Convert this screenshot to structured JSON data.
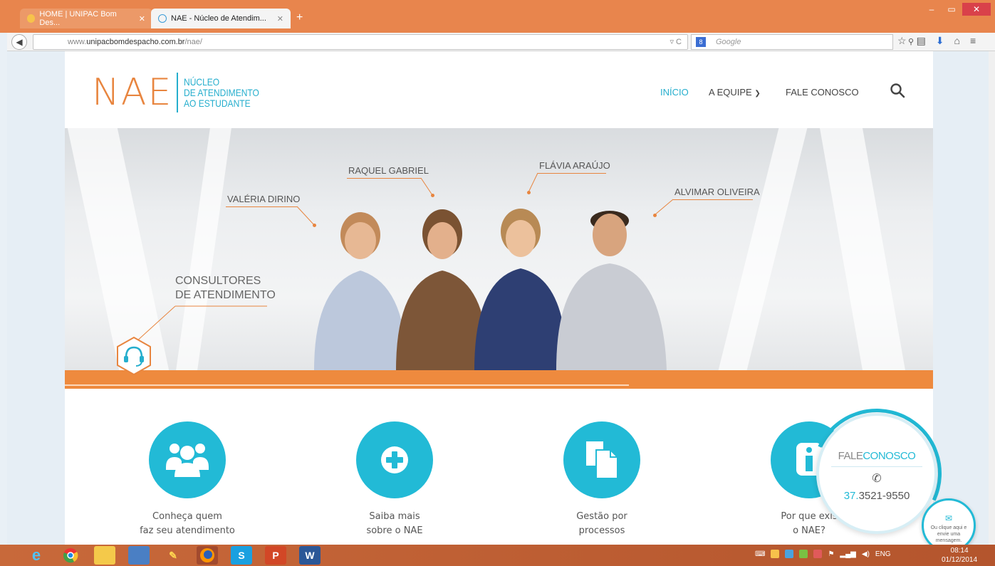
{
  "browser": {
    "tabs": [
      {
        "label": "HOME | UNIPAC Bom Des...",
        "active": false
      },
      {
        "label": "NAE - Núcleo de Atendim...",
        "active": true
      }
    ],
    "url_prefix": "www.",
    "url_domain": "unipacbomdespacho.com.br",
    "url_path": "/nae/",
    "search_placeholder": "Google"
  },
  "site": {
    "logo_main": "NAE",
    "logo_lines": [
      "NÚCLEO",
      "DE ATENDIMENTO",
      "AO ESTUDANTE"
    ],
    "menu": {
      "inicio": "INÍCIO",
      "equipe": "A EQUIPE",
      "fale": "FALE CONOSCO"
    },
    "accent": "#22bad6",
    "brand_orange": "#e8853f"
  },
  "hero": {
    "names": [
      "VALÉRIA DIRINO",
      "RAQUEL GABRIEL",
      "FLÁVIA ARAÚJO",
      "ALVIMAR OLIVEIRA"
    ],
    "consultores_line1": "CONSULTORES",
    "consultores_line2": "DE ATENDIMENTO"
  },
  "features": [
    {
      "icon": "users-icon",
      "line1": "Conheça quem",
      "line2": "faz seu atendimento"
    },
    {
      "icon": "plus-icon",
      "line1": "Saiba mais",
      "line2": "sobre o NAE"
    },
    {
      "icon": "document-icon",
      "line1": "Gestão por",
      "line2": "processos"
    },
    {
      "icon": "info-icon",
      "line1": "Por que exis",
      "line2": "o NAE?"
    }
  ],
  "contact_widget": {
    "title_a": "FALE",
    "title_b": "CONOSCO",
    "phone_area": "37.",
    "phone_number": "3521-9550",
    "message_text": "Ou clique aqui e envie uma mensagem."
  },
  "taskbar": {
    "lang": "ENG",
    "time": "08:14",
    "date": "01/12/2014"
  }
}
